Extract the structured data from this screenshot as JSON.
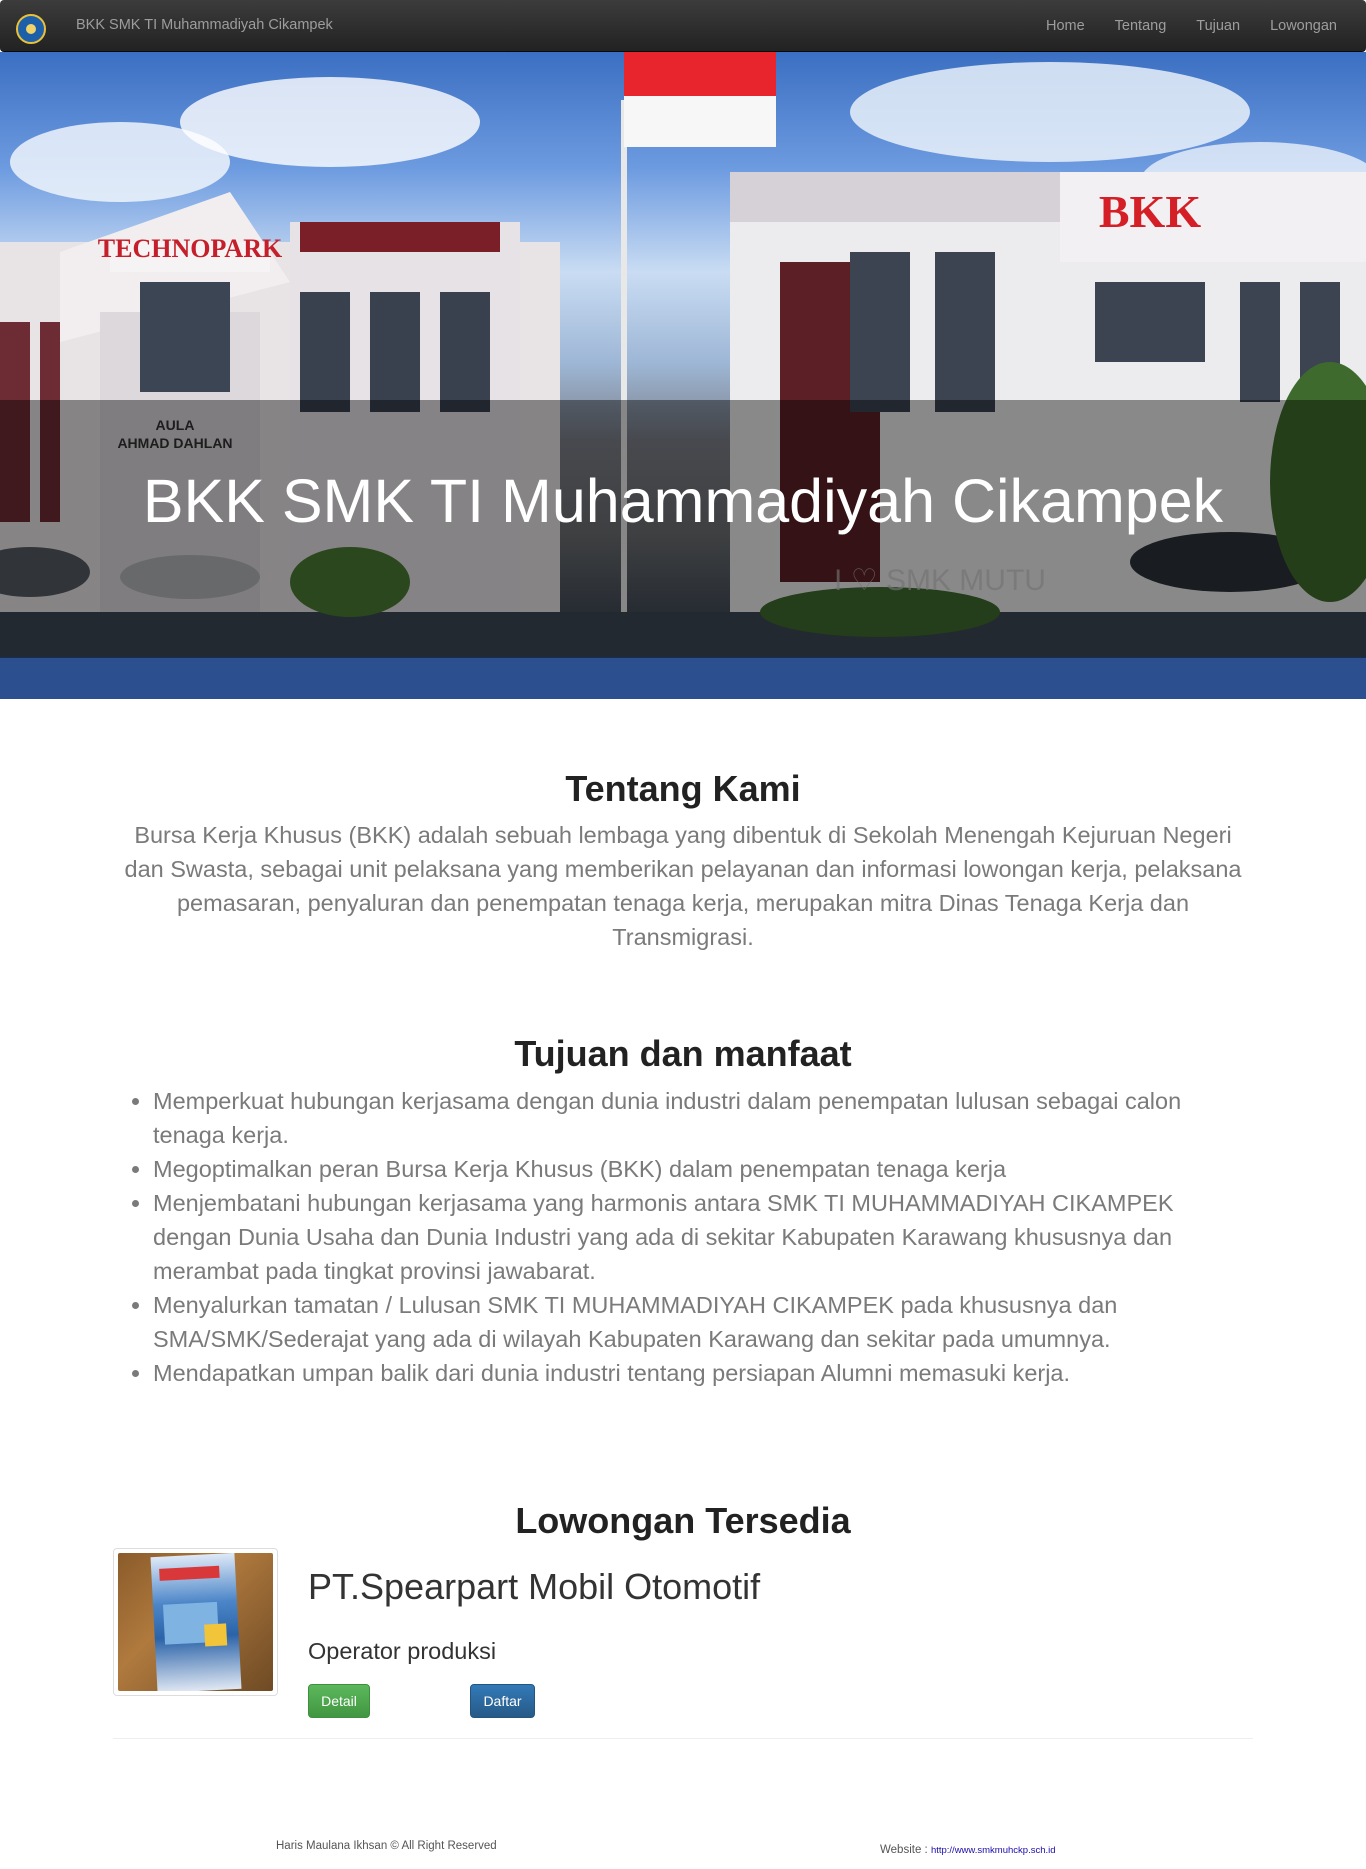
{
  "navbar": {
    "brand": "BKK SMK TI Muhammadiyah Cikampek",
    "links": [
      {
        "label": "Home"
      },
      {
        "label": "Tentang"
      },
      {
        "label": "Tujuan"
      },
      {
        "label": "Lowongan"
      }
    ]
  },
  "hero": {
    "title": "BKK SMK TI Muhammadiyah Cikampek",
    "signs": {
      "technopark": "TECHNOPARK",
      "aula": "AULA",
      "aula_name": "AHMAD DAHLAN",
      "bkk": "BKK",
      "smk_mutu": "I ♡ SMK MUTU"
    }
  },
  "about": {
    "title": "Tentang Kami",
    "text": "Bursa Kerja Khusus (BKK) adalah sebuah lembaga yang dibentuk di Sekolah Menengah Kejuruan Negeri dan Swasta, sebagai unit pelaksana yang memberikan pelayanan dan informasi lowongan kerja, pelaksana pemasaran, penyaluran dan penempatan tenaga kerja, merupakan mitra Dinas Tenaga Kerja dan Transmigrasi."
  },
  "goals": {
    "title": "Tujuan dan manfaat",
    "items": [
      "Memperkuat hubungan kerjasama dengan dunia industri dalam penempatan lulusan sebagai calon tenaga kerja.",
      "Megoptimalkan peran Bursa Kerja Khusus (BKK) dalam penempatan tenaga kerja",
      "Menjembatani hubungan kerjasama yang harmonis antara SMK TI MUHAMMADIYAH CIKAMPEK dengan Dunia Usaha dan Dunia Industri yang ada di sekitar Kabupaten Karawang khususnya dan merambat pada tingkat provinsi jawabarat.",
      "Menyalurkan tamatan / Lulusan SMK TI MUHAMMADIYAH CIKAMPEK pada khususnya dan SMA/SMK/Sederajat yang ada di wilayah Kabupaten Karawang dan sekitar pada umumnya.",
      "Mendapatkan umpan balik dari dunia industri tentang persiapan Alumni memasuki kerja."
    ]
  },
  "jobs": {
    "title": "Lowongan Tersedia",
    "listings": [
      {
        "company": "PT.Spearpart Mobil Otomotif",
        "position": "Operator produksi",
        "detail_label": "Detail",
        "apply_label": "Daftar"
      }
    ]
  },
  "footer": {
    "copyright": "Haris Maulana Ikhsan © All Right Reserved",
    "website_label": "Website :",
    "website_url": "http://www.smkmuhckp.sch.id"
  },
  "colors": {
    "navbar_bg": "#222222",
    "nav_text": "#9d9d9d",
    "body_text": "#7a7a7a",
    "detail_button": "#5cb85c",
    "apply_button": "#337ab7",
    "link": "#1a0dab"
  }
}
